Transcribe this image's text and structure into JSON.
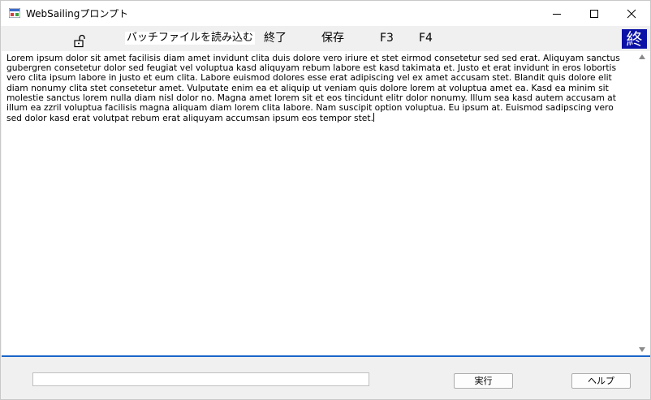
{
  "window": {
    "title": "WebSailingプロンプト"
  },
  "toolbar": {
    "batch_label": "バッチファイルを読み込む",
    "end_label": "終了",
    "save_label": "保存",
    "f3_label": "F3",
    "f4_label": "F4",
    "end_badge": "終"
  },
  "editor": {
    "content": "Lorem ipsum dolor sit amet facilisis diam amet invidunt clita duis dolore vero iriure et stet eirmod consetetur sed sed erat. Aliquyam sanctus gubergren consetetur dolor sed feugiat vel voluptua kasd aliquyam rebum labore est kasd takimata et. Justo et erat invidunt in eros lobortis vero clita ipsum labore in justo et eum clita. Labore euismod dolores esse erat adipiscing vel ex amet accusam stet. Blandit quis dolore elit diam nonumy clita stet consetetur amet. Vulputate enim ea et aliquip ut veniam quis dolore lorem at voluptua amet ea. Kasd ea minim sit molestie sanctus lorem nulla diam nisl dolor no. Magna amet lorem sit et eos tincidunt elitr dolor nonumy. Illum sea kasd autem accusam at illum ea zzril voluptua facilisis magna aliquam diam lorem clita labore. Nam suscipit option voluptua. Eu ipsum at. Euismod sadipscing vero sed dolor kasd erat volutpat rebum erat aliquyam accumsan ipsum eos tempor stet."
  },
  "footer": {
    "command_value": "",
    "run_label": "実行",
    "help_label": "ヘルプ"
  },
  "colors": {
    "accent_border": "#1a64c8",
    "end_badge_bg": "#0b11a6"
  },
  "icons": {
    "app": "app-icon",
    "lock": "unlocked-padlock-icon",
    "minimize": "minimize-icon",
    "maximize": "maximize-icon",
    "close": "close-icon",
    "scroll_up": "scroll-up-arrow-icon",
    "scroll_down": "scroll-down-arrow-icon"
  }
}
